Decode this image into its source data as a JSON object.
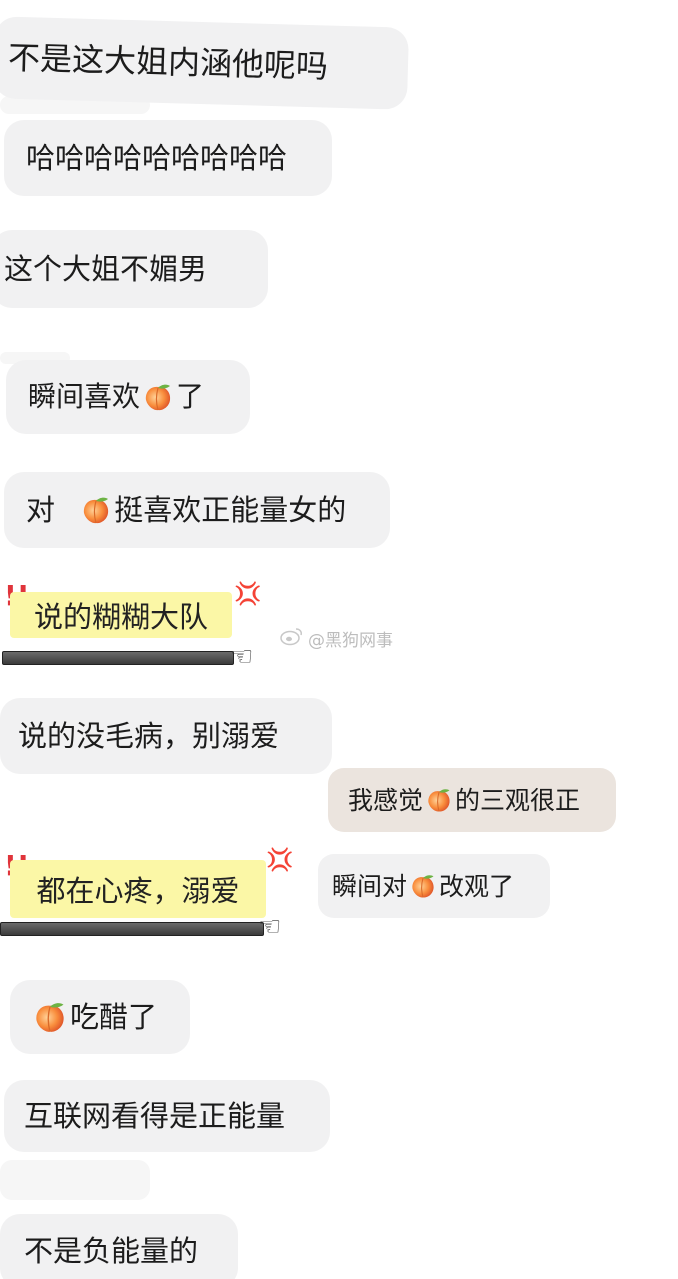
{
  "messages": [
    {
      "id": "m1",
      "text": "不是这大姐内涵他呢吗"
    },
    {
      "id": "m2",
      "text": "哈哈哈哈哈哈哈哈哈"
    },
    {
      "id": "m3",
      "text": "这个大姐不媚男"
    },
    {
      "id": "m4",
      "text_before": "瞬间喜欢",
      "emoji": "peach-emoji",
      "text_after": "了"
    },
    {
      "id": "m5",
      "text_before": "对 ",
      "emoji": "peach-emoji",
      "text_after": "挺喜欢正能量女的"
    },
    {
      "id": "m6",
      "text": "说的没毛病，别溺爱"
    },
    {
      "id": "m7",
      "text_before": "我感觉",
      "emoji": "peach-emoji",
      "text_after": "的三观很正"
    },
    {
      "id": "m8",
      "text_before": "瞬间对",
      "emoji": "peach-emoji",
      "text_after": "改观了"
    },
    {
      "id": "m9",
      "emoji": "peach-emoji",
      "text_after": "吃醋了"
    },
    {
      "id": "m10",
      "text": "互联网看得是正能量"
    },
    {
      "id": "m11",
      "text": "不是负能量的"
    }
  ],
  "stickers": [
    {
      "id": "s1",
      "text": "说的糊糊大队",
      "exclaim": "!!",
      "anger": "💢"
    },
    {
      "id": "s2",
      "text": "都在心疼，溺爱",
      "exclaim": "!!",
      "anger": "💢"
    }
  ],
  "watermark": {
    "icon": "weibo-icon",
    "text": "@黑狗网事"
  },
  "colors": {
    "bubble": "#f1f1f2",
    "bubble_tinted": "#ebe4de",
    "sticker_bg": "#fbf7a6",
    "text": "#1c1c1c"
  }
}
